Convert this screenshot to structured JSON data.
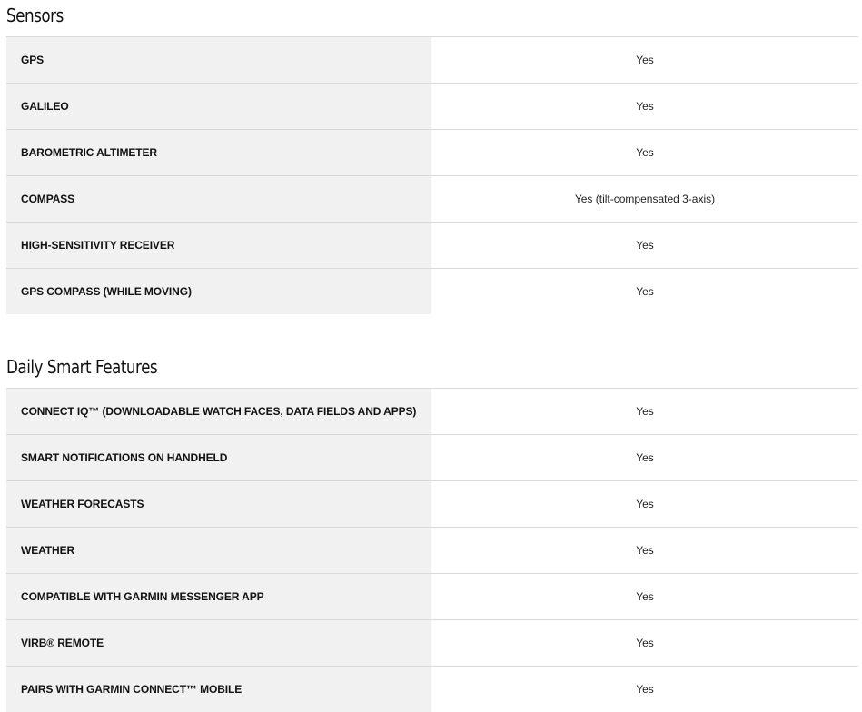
{
  "sensors": {
    "title": "Sensors",
    "rows": [
      {
        "label": "GPS",
        "value": "Yes"
      },
      {
        "label": "GALILEO",
        "value": "Yes"
      },
      {
        "label": "BAROMETRIC ALTIMETER",
        "value": "Yes"
      },
      {
        "label": "COMPASS",
        "value": "Yes (tilt-compensated 3-axis)"
      },
      {
        "label": "HIGH-SENSITIVITY RECEIVER",
        "value": "Yes"
      },
      {
        "label": "GPS COMPASS (WHILE MOVING)",
        "value": "Yes"
      }
    ]
  },
  "daily_smart_features": {
    "title": "Daily Smart Features",
    "rows": [
      {
        "label": "CONNECT IQ™ (DOWNLOADABLE WATCH FACES, DATA FIELDS AND APPS)",
        "value": "Yes"
      },
      {
        "label": "SMART NOTIFICATIONS ON HANDHELD",
        "value": "Yes"
      },
      {
        "label": "WEATHER FORECASTS",
        "value": "Yes"
      },
      {
        "label": "WEATHER",
        "value": "Yes"
      },
      {
        "label": "COMPATIBLE WITH GARMIN MESSENGER APP",
        "value": "Yes"
      },
      {
        "label": "VIRB® REMOTE",
        "value": "Yes"
      },
      {
        "label": "PAIRS WITH GARMIN CONNECT™ MOBILE",
        "value": "Yes"
      }
    ]
  }
}
